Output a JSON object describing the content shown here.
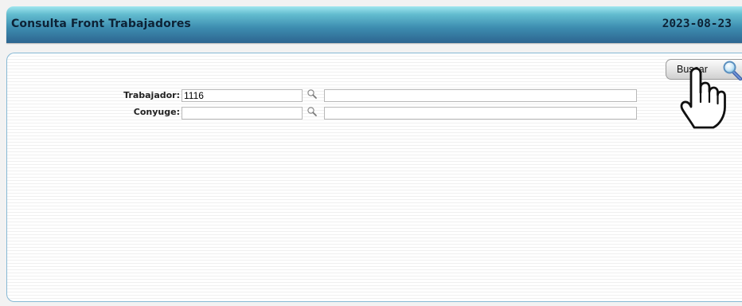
{
  "header": {
    "title": "Consulta Front Trabajadores",
    "date": "2023-08-23"
  },
  "toolbar": {
    "search_label": "Buscar",
    "search_icon": "magnifier-icon"
  },
  "form": {
    "trabajador": {
      "label": "Trabajador:",
      "code_value": "1116",
      "name_value": ""
    },
    "conyuge": {
      "label": "Conyuge:",
      "code_value": "",
      "name_value": ""
    }
  },
  "cursor": "hand-pointer-icon",
  "colors": {
    "header_top": "#9fe6ef",
    "header_bottom": "#2d6590",
    "header_text": "#0d2236",
    "panel_border": "#86b8d4"
  }
}
